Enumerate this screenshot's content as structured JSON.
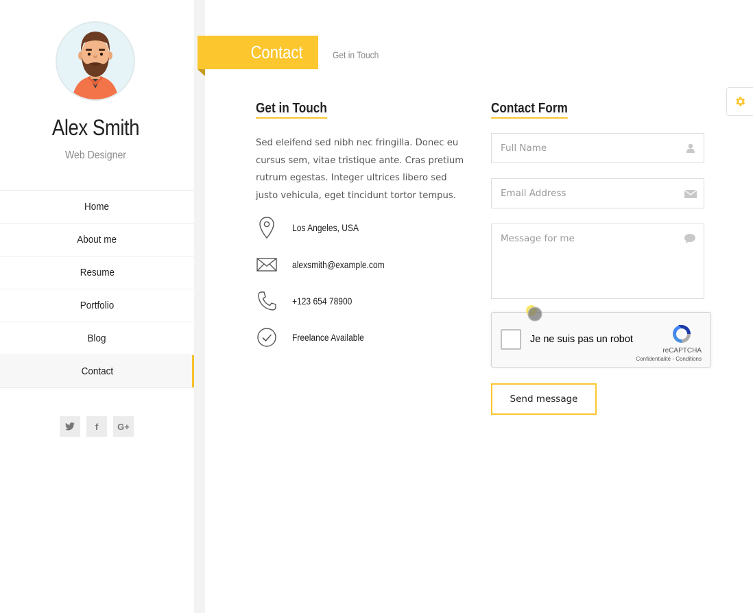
{
  "profile": {
    "name": "Alex Smith",
    "role": "Web Designer"
  },
  "nav": {
    "items": [
      {
        "label": "Home"
      },
      {
        "label": "About me"
      },
      {
        "label": "Resume"
      },
      {
        "label": "Portfolio"
      },
      {
        "label": "Blog"
      },
      {
        "label": "Contact",
        "active": true
      }
    ]
  },
  "social": {
    "twitter_glyph": "⬆",
    "facebook_glyph": "f",
    "googleplus_glyph": "G+"
  },
  "page": {
    "title": "Contact",
    "subtitle": "Get in Touch"
  },
  "get_in_touch": {
    "heading": "Get in Touch",
    "intro": "Sed eleifend sed nibh nec fringilla. Donec eu cursus sem, vitae tristique ante. Cras pretium rutrum egestas. Integer ultrices libero sed justo vehicula, eget tincidunt tortor tempus.",
    "info": [
      {
        "icon": "location-pin-icon",
        "text": "Los Angeles, USA"
      },
      {
        "icon": "envelope-icon",
        "text": "alexsmith@example.com"
      },
      {
        "icon": "phone-icon",
        "text": "+123 654 78900"
      },
      {
        "icon": "check-circle-icon",
        "text": "Freelance Available"
      }
    ]
  },
  "contact_form": {
    "heading": "Contact Form",
    "name_placeholder": "Full Name",
    "email_placeholder": "Email Address",
    "message_placeholder": "Message for me",
    "recaptcha_label": "Je ne suis pas un robot",
    "recaptcha_brand": "reCAPTCHA",
    "recaptcha_terms": "Confidentialité - Conditions",
    "send_label": "Send message"
  },
  "colors": {
    "accent": "#fcc62f",
    "text_dark": "#222222",
    "text_muted": "#888888"
  }
}
